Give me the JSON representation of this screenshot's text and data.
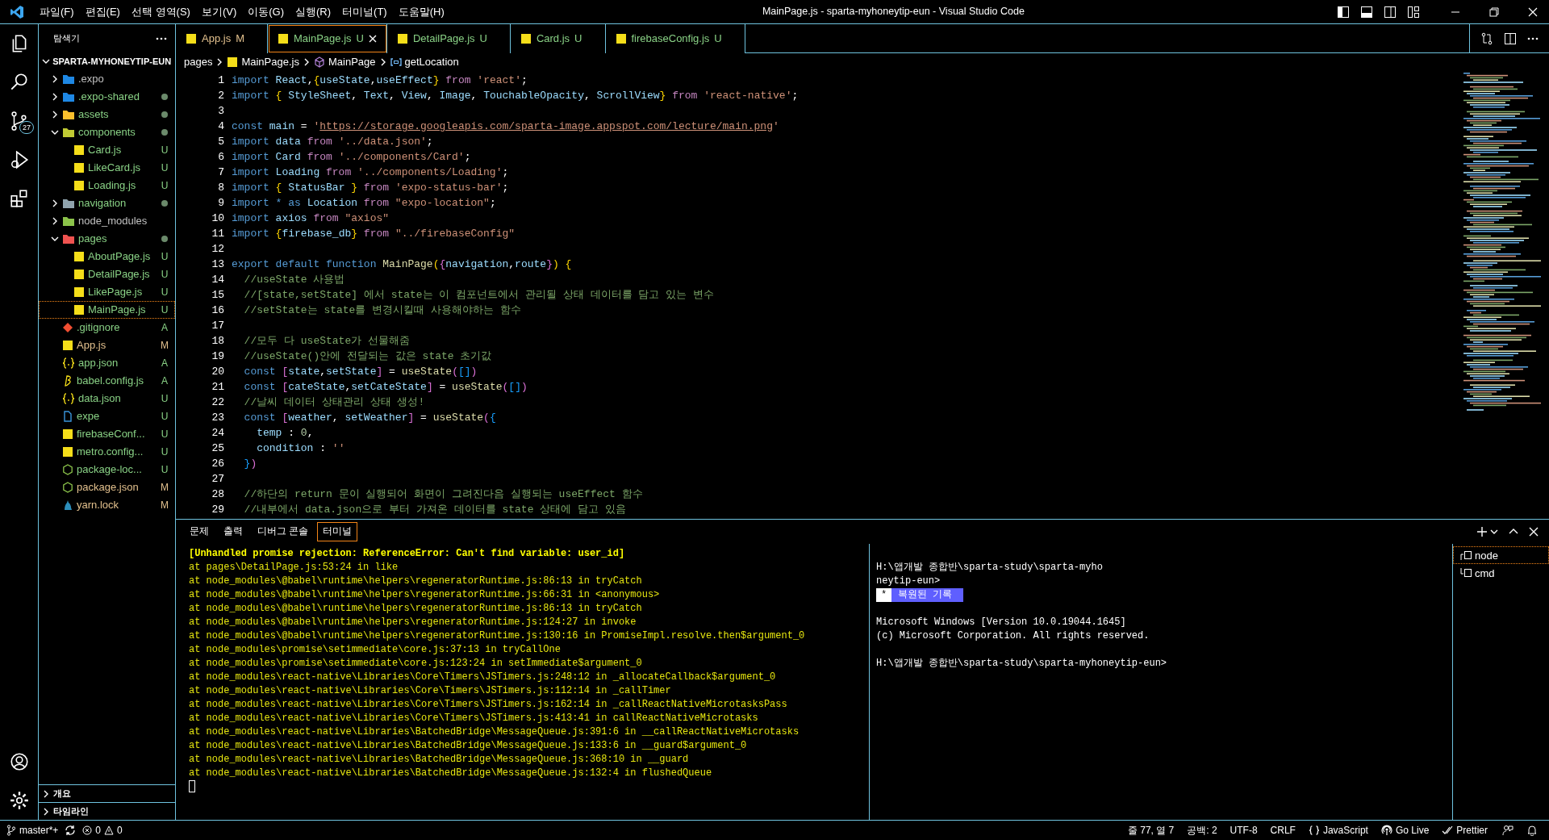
{
  "title_bar": {
    "menu": [
      "파일(F)",
      "편집(E)",
      "선택 영역(S)",
      "보기(V)",
      "이동(G)",
      "실행(R)",
      "터미널(T)",
      "도움말(H)"
    ],
    "title": "MainPage.js - sparta-myhoneytip-eun - Visual Studio Code"
  },
  "activity_bar": {
    "source_control_badge": "27"
  },
  "explorer": {
    "title": "탐색기",
    "root": "SPARTA-MYHONEYTIP-EUN",
    "items": [
      {
        "name": ".expo",
        "kind": "expo",
        "expanded": false,
        "modified": false,
        "selected": false
      },
      {
        "name": ".expo-shared",
        "kind": "expo",
        "expanded": false,
        "modified": true,
        "selected": false
      },
      {
        "name": "assets",
        "kind": "assets",
        "expanded": false,
        "modified": true,
        "selected": false
      },
      {
        "name": "components",
        "kind": "components",
        "expanded": true,
        "modified": true,
        "selected": false,
        "children": [
          {
            "name": "Card.js",
            "kind": "js",
            "status": "U",
            "selected": false
          },
          {
            "name": "LikeCard.js",
            "kind": "js",
            "status": "U",
            "selected": false
          },
          {
            "name": "Loading.js",
            "kind": "js",
            "status": "U",
            "selected": false
          }
        ]
      },
      {
        "name": "navigation",
        "kind": "folder",
        "expanded": false,
        "modified": true,
        "selected": false
      },
      {
        "name": "node_modules",
        "kind": "node",
        "expanded": false,
        "modified": false,
        "selected": false
      },
      {
        "name": "pages",
        "kind": "pages",
        "expanded": true,
        "modified": true,
        "selected": false,
        "children": [
          {
            "name": "AboutPage.js",
            "kind": "js",
            "status": "U",
            "selected": false
          },
          {
            "name": "DetailPage.js",
            "kind": "js",
            "status": "U",
            "selected": false
          },
          {
            "name": "LikePage.js",
            "kind": "js",
            "status": "U",
            "selected": false
          },
          {
            "name": "MainPage.js",
            "kind": "js",
            "status": "U",
            "selected": true
          }
        ]
      },
      {
        "name": ".gitignore",
        "kind": "git",
        "status": "A",
        "selected": false
      },
      {
        "name": "App.js",
        "kind": "js",
        "status": "M",
        "selected": false
      },
      {
        "name": "app.json",
        "kind": "json",
        "status": "A",
        "selected": false
      },
      {
        "name": "babel.config.js",
        "kind": "babel",
        "status": "A",
        "selected": false
      },
      {
        "name": "data.json",
        "kind": "json",
        "status": "U",
        "selected": false
      },
      {
        "name": "expe",
        "kind": "file",
        "status": "U",
        "selected": false
      },
      {
        "name": "firebaseConf...",
        "kind": "js",
        "status": "U",
        "selected": false
      },
      {
        "name": "metro.config...",
        "kind": "js",
        "status": "U",
        "selected": false
      },
      {
        "name": "package-loc...",
        "kind": "npm",
        "status": "U",
        "selected": false
      },
      {
        "name": "package.json",
        "kind": "npm",
        "status": "M",
        "selected": false
      },
      {
        "name": "yarn.lock",
        "kind": "yarn",
        "status": "M",
        "selected": false
      }
    ],
    "sections": [
      "개요",
      "타임라인"
    ]
  },
  "tabs": [
    {
      "label": "App.js",
      "status": "M",
      "selected": false
    },
    {
      "label": "MainPage.js",
      "status": "U",
      "selected": true
    },
    {
      "label": "DetailPage.js",
      "status": "U",
      "selected": false
    },
    {
      "label": "Card.js",
      "status": "U",
      "selected": false
    },
    {
      "label": "firebaseConfig.js",
      "status": "U",
      "selected": false
    }
  ],
  "breadcrumb": [
    {
      "kind": "folder",
      "text": "pages"
    },
    {
      "kind": "js",
      "text": "MainPage.js"
    },
    {
      "kind": "function",
      "text": "MainPage"
    },
    {
      "kind": "variable",
      "text": "getLocation"
    }
  ],
  "code_lines": [
    {
      "number": "1",
      "tokens": [
        {
          "kind": "kw",
          "text": "import "
        },
        {
          "kind": "id",
          "text": "React"
        },
        {
          "kind": "p",
          "text": ","
        },
        {
          "kind": "br",
          "text": "{"
        },
        {
          "kind": "id",
          "text": "useState"
        },
        {
          "kind": "p",
          "text": ","
        },
        {
          "kind": "id",
          "text": "useEffect"
        },
        {
          "kind": "br",
          "text": "}"
        },
        {
          "kind": "ctl",
          "text": " from "
        },
        {
          "kind": "str",
          "text": "'react'"
        },
        {
          "kind": "p",
          "text": ";"
        }
      ]
    },
    {
      "number": "2",
      "tokens": [
        {
          "kind": "kw",
          "text": "import "
        },
        {
          "kind": "br",
          "text": "{"
        },
        {
          "kind": "id",
          "text": " StyleSheet"
        },
        {
          "kind": "p",
          "text": ", "
        },
        {
          "kind": "id",
          "text": "Text"
        },
        {
          "kind": "p",
          "text": ", "
        },
        {
          "kind": "id",
          "text": "View"
        },
        {
          "kind": "p",
          "text": ", "
        },
        {
          "kind": "id",
          "text": "Image"
        },
        {
          "kind": "p",
          "text": ", "
        },
        {
          "kind": "id",
          "text": "TouchableOpacity"
        },
        {
          "kind": "p",
          "text": ", "
        },
        {
          "kind": "id",
          "text": "ScrollView"
        },
        {
          "kind": "br",
          "text": "}"
        },
        {
          "kind": "ctl",
          "text": " from "
        },
        {
          "kind": "str",
          "text": "'react-native'"
        },
        {
          "kind": "p",
          "text": ";"
        }
      ]
    },
    {
      "number": "3"
    },
    {
      "number": "4",
      "tokens": [
        {
          "kind": "kw",
          "text": "const "
        },
        {
          "kind": "id",
          "text": "main"
        },
        {
          "kind": "p",
          "text": " = "
        },
        {
          "kind": "str",
          "text": "'"
        },
        {
          "kind": "link",
          "text": "https://storage.googleapis.com/sparta-image.appspot.com/lecture/main.png"
        },
        {
          "kind": "str",
          "text": "'"
        }
      ]
    },
    {
      "number": "5",
      "tokens": [
        {
          "kind": "kw",
          "text": "import "
        },
        {
          "kind": "id",
          "text": "data"
        },
        {
          "kind": "ctl",
          "text": " from "
        },
        {
          "kind": "str",
          "text": "'../data.json'"
        },
        {
          "kind": "p",
          "text": ";"
        }
      ]
    },
    {
      "number": "6",
      "tokens": [
        {
          "kind": "kw",
          "text": "import "
        },
        {
          "kind": "id",
          "text": "Card"
        },
        {
          "kind": "ctl",
          "text": " from "
        },
        {
          "kind": "str",
          "text": "'../components/Card'"
        },
        {
          "kind": "p",
          "text": ";"
        }
      ]
    },
    {
      "number": "7",
      "tokens": [
        {
          "kind": "kw",
          "text": "import "
        },
        {
          "kind": "id",
          "text": "Loading"
        },
        {
          "kind": "ctl",
          "text": " from "
        },
        {
          "kind": "str",
          "text": "'../components/Loading'"
        },
        {
          "kind": "p",
          "text": ";"
        }
      ]
    },
    {
      "number": "8",
      "tokens": [
        {
          "kind": "kw",
          "text": "import "
        },
        {
          "kind": "br",
          "text": "{"
        },
        {
          "kind": "id",
          "text": " StatusBar "
        },
        {
          "kind": "br",
          "text": "}"
        },
        {
          "kind": "ctl",
          "text": " from "
        },
        {
          "kind": "str",
          "text": "'expo-status-bar'"
        },
        {
          "kind": "p",
          "text": ";"
        }
      ]
    },
    {
      "number": "9",
      "tokens": [
        {
          "kind": "kw",
          "text": "import "
        },
        {
          "kind": "kw",
          "text": "* as "
        },
        {
          "kind": "id",
          "text": "Location"
        },
        {
          "kind": "ctl",
          "text": " from "
        },
        {
          "kind": "str",
          "text": "\"expo-location\""
        },
        {
          "kind": "p",
          "text": ";"
        }
      ]
    },
    {
      "number": "10",
      "tokens": [
        {
          "kind": "kw",
          "text": "import "
        },
        {
          "kind": "id",
          "text": "axios"
        },
        {
          "kind": "ctl",
          "text": " from "
        },
        {
          "kind": "str",
          "text": "\"axios\""
        }
      ]
    },
    {
      "number": "11",
      "tokens": [
        {
          "kind": "kw",
          "text": "import "
        },
        {
          "kind": "br",
          "text": "{"
        },
        {
          "kind": "id",
          "text": "firebase_db"
        },
        {
          "kind": "br",
          "text": "}"
        },
        {
          "kind": "ctl",
          "text": " from "
        },
        {
          "kind": "str",
          "text": "\"../firebaseConfig\""
        }
      ]
    },
    {
      "number": "12"
    },
    {
      "number": "13",
      "tokens": [
        {
          "kind": "kw",
          "text": "export default function "
        },
        {
          "kind": "fn",
          "text": "MainPage"
        },
        {
          "kind": "br",
          "text": "("
        },
        {
          "kind": "br2",
          "text": "{"
        },
        {
          "kind": "id",
          "text": "navigation"
        },
        {
          "kind": "p",
          "text": ","
        },
        {
          "kind": "id",
          "text": "route"
        },
        {
          "kind": "br2",
          "text": "}"
        },
        {
          "kind": "br",
          "text": ")"
        },
        {
          "kind": "br",
          "text": " {"
        }
      ]
    },
    {
      "number": "14",
      "tokens": [
        {
          "kind": "cm",
          "text": "  //useState 사용법"
        }
      ]
    },
    {
      "number": "15",
      "tokens": [
        {
          "kind": "cm",
          "text": "  //[state,setState] 에서 state는 이 컴포넌트에서 관리될 상태 데이터를 담고 있는 변수"
        }
      ]
    },
    {
      "number": "16",
      "tokens": [
        {
          "kind": "cm",
          "text": "  //setState는 state를 변경시킬때 사용해야하는 함수"
        }
      ]
    },
    {
      "number": "17"
    },
    {
      "number": "18",
      "tokens": [
        {
          "kind": "cm",
          "text": "  //모두 다 useState가 선물해줌"
        }
      ]
    },
    {
      "number": "19",
      "tokens": [
        {
          "kind": "cm",
          "text": "  //useState()안에 전달되는 값은 state 초기값"
        }
      ]
    },
    {
      "number": "20",
      "tokens": [
        {
          "kind": "kw",
          "text": "  const "
        },
        {
          "kind": "br2",
          "text": "["
        },
        {
          "kind": "id",
          "text": "state"
        },
        {
          "kind": "p",
          "text": ","
        },
        {
          "kind": "id",
          "text": "setState"
        },
        {
          "kind": "br2",
          "text": "]"
        },
        {
          "kind": "p",
          "text": " = "
        },
        {
          "kind": "fn",
          "text": "useState"
        },
        {
          "kind": "br2",
          "text": "("
        },
        {
          "kind": "br3",
          "text": "[]"
        },
        {
          "kind": "br2",
          "text": ")"
        }
      ]
    },
    {
      "number": "21",
      "tokens": [
        {
          "kind": "kw",
          "text": "  const "
        },
        {
          "kind": "br2",
          "text": "["
        },
        {
          "kind": "id",
          "text": "cateState"
        },
        {
          "kind": "p",
          "text": ","
        },
        {
          "kind": "id",
          "text": "setCateState"
        },
        {
          "kind": "br2",
          "text": "]"
        },
        {
          "kind": "p",
          "text": " = "
        },
        {
          "kind": "fn",
          "text": "useState"
        },
        {
          "kind": "br2",
          "text": "("
        },
        {
          "kind": "br3",
          "text": "[]"
        },
        {
          "kind": "br2",
          "text": ")"
        }
      ]
    },
    {
      "number": "22",
      "tokens": [
        {
          "kind": "cm",
          "text": "  //날씨 데이터 상태관리 상태 생성!"
        }
      ]
    },
    {
      "number": "23",
      "tokens": [
        {
          "kind": "kw",
          "text": "  const "
        },
        {
          "kind": "br2",
          "text": "["
        },
        {
          "kind": "id",
          "text": "weather"
        },
        {
          "kind": "p",
          "text": ", "
        },
        {
          "kind": "id",
          "text": "setWeather"
        },
        {
          "kind": "br2",
          "text": "]"
        },
        {
          "kind": "p",
          "text": " = "
        },
        {
          "kind": "fn",
          "text": "useState"
        },
        {
          "kind": "br2",
          "text": "("
        },
        {
          "kind": "br3",
          "text": "{"
        }
      ]
    },
    {
      "number": "24",
      "tokens": [
        {
          "kind": "id",
          "text": "    temp"
        },
        {
          "kind": "p",
          "text": " : "
        },
        {
          "kind": "num",
          "text": "0"
        },
        {
          "kind": "p",
          "text": ","
        }
      ]
    },
    {
      "number": "25",
      "tokens": [
        {
          "kind": "id",
          "text": "    condition"
        },
        {
          "kind": "p",
          "text": " : "
        },
        {
          "kind": "str",
          "text": "''"
        }
      ]
    },
    {
      "number": "26",
      "tokens": [
        {
          "kind": "br3",
          "text": "  }"
        },
        {
          "kind": "br2",
          "text": ")"
        }
      ]
    },
    {
      "number": "27"
    },
    {
      "number": "28",
      "tokens": [
        {
          "kind": "cm",
          "text": "  //하단의 return 문이 실행되어 화면이 그려진다음 실행되는 useEffect 함수"
        }
      ]
    },
    {
      "number": "29",
      "tokens": [
        {
          "kind": "cm",
          "text": "  //내부에서 data.json으로 부터 가져온 데이터를 state 상태에 담고 있음"
        }
      ]
    }
  ],
  "panel": {
    "tabs": [
      {
        "label": "문제",
        "selected": false
      },
      {
        "label": "출력",
        "selected": false
      },
      {
        "label": "디버그 콘솔",
        "selected": false
      },
      {
        "label": "터미널",
        "selected": true
      }
    ],
    "output_lines": [
      {
        "kind": "error",
        "text": "[Unhandled promise rejection: ReferenceError: Can't find variable: user_id]"
      },
      {
        "kind": "trace",
        "text": "at pages\\DetailPage.js:53:24 in like"
      },
      {
        "kind": "trace",
        "text": "at node_modules\\@babel\\runtime\\helpers\\regeneratorRuntime.js:86:13 in tryCatch"
      },
      {
        "kind": "trace",
        "text": "at node_modules\\@babel\\runtime\\helpers\\regeneratorRuntime.js:66:31 in <anonymous>"
      },
      {
        "kind": "trace",
        "text": "at node_modules\\@babel\\runtime\\helpers\\regeneratorRuntime.js:86:13 in tryCatch"
      },
      {
        "kind": "trace",
        "text": "at node_modules\\@babel\\runtime\\helpers\\regeneratorRuntime.js:124:27 in invoke"
      },
      {
        "kind": "trace",
        "text": "at node_modules\\@babel\\runtime\\helpers\\regeneratorRuntime.js:130:16 in PromiseImpl.resolve.then$argument_0"
      },
      {
        "kind": "trace",
        "text": "at node_modules\\promise\\setimmediate\\core.js:37:13 in tryCallOne"
      },
      {
        "kind": "trace",
        "text": "at node_modules\\promise\\setimmediate\\core.js:123:24 in setImmediate$argument_0"
      },
      {
        "kind": "trace",
        "text": "at node_modules\\react-native\\Libraries\\Core\\Timers\\JSTimers.js:248:12 in _allocateCallback$argument_0"
      },
      {
        "kind": "trace",
        "text": "at node_modules\\react-native\\Libraries\\Core\\Timers\\JSTimers.js:112:14 in _callTimer"
      },
      {
        "kind": "trace",
        "text": "at node_modules\\react-native\\Libraries\\Core\\Timers\\JSTimers.js:162:14 in _callReactNativeMicrotasksPass"
      },
      {
        "kind": "trace",
        "text": "at node_modules\\react-native\\Libraries\\Core\\Timers\\JSTimers.js:413:41 in callReactNativeMicrotasks"
      },
      {
        "kind": "trace",
        "text": "at node_modules\\react-native\\Libraries\\BatchedBridge\\MessageQueue.js:391:6 in __callReactNativeMicrotasks"
      },
      {
        "kind": "trace",
        "text": "at node_modules\\react-native\\Libraries\\BatchedBridge\\MessageQueue.js:133:6 in __guard$argument_0"
      },
      {
        "kind": "trace",
        "text": "at node_modules\\react-native\\Libraries\\BatchedBridge\\MessageQueue.js:368:10 in __guard"
      },
      {
        "kind": "trace",
        "text": "at node_modules\\react-native\\Libraries\\BatchedBridge\\MessageQueue.js:132:4 in flushedQueue"
      }
    ],
    "shell_lines": [
      {
        "kind": "blank"
      },
      {
        "kind": "text",
        "text": "H:\\앱개발 종합반\\sparta-study\\sparta-myho"
      },
      {
        "kind": "text",
        "text": "neytip-eun>"
      },
      {
        "kind": "restored",
        "mark": "*",
        "text": "복원된 기록"
      },
      {
        "kind": "blank"
      },
      {
        "kind": "text",
        "text": "Microsoft Windows [Version 10.0.19044.1645]"
      },
      {
        "kind": "text",
        "text": "(c) Microsoft Corporation. All rights reserved."
      },
      {
        "kind": "blank"
      },
      {
        "kind": "text",
        "text": "H:\\앱개발 종합반\\sparta-study\\sparta-myhoneytip-eun>"
      }
    ],
    "terminals": [
      {
        "label": "node",
        "selected": true
      },
      {
        "label": "cmd",
        "selected": false
      }
    ]
  },
  "status_bar": {
    "branch": "master*+",
    "errors": "0",
    "warnings": "0",
    "right": [
      {
        "kind": "text",
        "text": "줄 77, 열 7"
      },
      {
        "kind": "text",
        "text": "공백: 2"
      },
      {
        "kind": "text",
        "text": "UTF-8"
      },
      {
        "kind": "text",
        "text": "CRLF"
      },
      {
        "kind": "braces",
        "text": "JavaScript"
      },
      {
        "kind": "broadcast",
        "text": "Go Live"
      },
      {
        "kind": "checks",
        "text": "Prettier"
      }
    ]
  }
}
